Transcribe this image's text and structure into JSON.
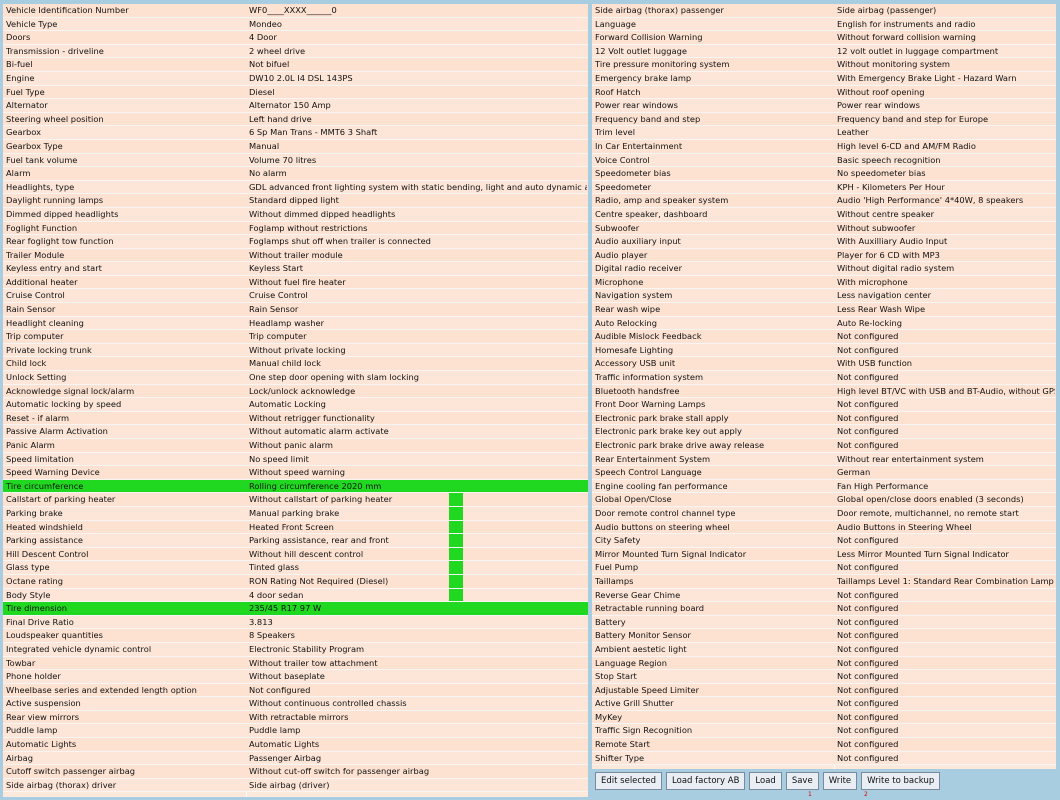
{
  "left_rows": [
    [
      "Vehicle Identification Number",
      "WF0____XXXX______0"
    ],
    [
      "Vehicle Type",
      "Mondeo"
    ],
    [
      "Doors",
      "4 Door"
    ],
    [
      "Transmission - driveline",
      "2 wheel drive"
    ],
    [
      "Bi-fuel",
      "Not bifuel"
    ],
    [
      "Engine",
      "DW10 2.0L I4 DSL 143PS"
    ],
    [
      "Fuel Type",
      "Diesel"
    ],
    [
      "Alternator",
      "Alternator 150 Amp"
    ],
    [
      "Steering wheel position",
      "Left hand drive"
    ],
    [
      "Gearbox",
      "6 Sp Man Trans - MMT6 3 Shaft"
    ],
    [
      "Gearbox Type",
      "Manual"
    ],
    [
      "Fuel tank volume",
      "Volume 70 litres"
    ],
    [
      "Alarm",
      "No alarm"
    ],
    [
      "Headlights, type",
      "GDL advanced front lighting system with static bending, light and auto dynamic adjust"
    ],
    [
      "Daylight running lamps",
      "Standard dipped light"
    ],
    [
      "Dimmed dipped headlights",
      "Without dimmed dipped headlights"
    ],
    [
      "Foglight Function",
      "Foglamp without restrictions"
    ],
    [
      "Rear foglight tow function",
      "Foglamps shut off when trailer is connected"
    ],
    [
      "Trailer Module",
      "Without trailer module"
    ],
    [
      "Keyless entry and start",
      "Keyless Start"
    ],
    [
      "Additional heater",
      "Without fuel fire heater"
    ],
    [
      "Cruise Control",
      "Cruise Control"
    ],
    [
      "Rain Sensor",
      "Rain Sensor"
    ],
    [
      "Headlight cleaning",
      "Headlamp washer"
    ],
    [
      "Trip computer",
      "Trip computer"
    ],
    [
      "Private locking trunk",
      "Without private locking"
    ],
    [
      "Child lock",
      "Manual child lock"
    ],
    [
      "Unlock Setting",
      "One step door opening with slam locking"
    ],
    [
      "Acknowledge signal lock/alarm",
      "Lock/unlock acknowledge"
    ],
    [
      "Automatic locking by speed",
      "Automatic Locking"
    ],
    [
      "Reset - if alarm",
      "Without retrigger functionality"
    ],
    [
      "Passive Alarm Activation",
      "Without automatic alarm activate"
    ],
    [
      "Panic Alarm",
      "Without panic alarm"
    ],
    [
      "Speed limitation",
      "No speed limit"
    ],
    [
      "Speed Warning Device",
      "Without speed warning"
    ],
    [
      "Tire circumference",
      "Rolling circumference 2020 mm"
    ],
    [
      "Callstart of parking heater",
      "Without callstart of parking heater"
    ],
    [
      "Parking brake",
      "Manual parking brake"
    ],
    [
      "Heated windshield",
      "Heated Front Screen"
    ],
    [
      "Parking assistance",
      "Parking assistance, rear and front"
    ],
    [
      "Hill Descent Control",
      "Without hill descent control"
    ],
    [
      "Glass type",
      "Tinted glass"
    ],
    [
      "Octane rating",
      "RON Rating Not Required (Diesel)"
    ],
    [
      "Body Style",
      "4 door sedan"
    ],
    [
      "Tire dimension",
      "235/45 R17 97 W"
    ],
    [
      "Final Drive Ratio",
      "3.813"
    ],
    [
      "Loudspeaker quantities",
      "8 Speakers"
    ],
    [
      "Integrated vehicle dynamic control",
      "Electronic Stability Program"
    ],
    [
      "Towbar",
      "Without trailer tow attachment"
    ],
    [
      "Phone holder",
      "Without baseplate"
    ],
    [
      "Wheelbase series and extended length option",
      "Not configured"
    ],
    [
      "Active suspension",
      "Without continuous controlled chassis"
    ],
    [
      "Rear view mirrors",
      "With retractable mirrors"
    ],
    [
      "Puddle lamp",
      "Puddle lamp"
    ],
    [
      "Automatic Lights",
      "Automatic Lights"
    ],
    [
      "Airbag",
      "Passenger Airbag"
    ],
    [
      "Cutoff switch passenger airbag",
      "Without cut-off switch for passenger airbag"
    ],
    [
      "Side airbag (thorax) driver",
      "Side airbag (driver)"
    ]
  ],
  "right_rows": [
    [
      "Side airbag (thorax) passenger",
      "Side airbag (passenger)"
    ],
    [
      "Language",
      "English for instruments and radio"
    ],
    [
      "Forward Collision Warning",
      "Without forward collision warning"
    ],
    [
      "12 Volt outlet luggage",
      "12 volt outlet in luggage compartment"
    ],
    [
      "Tire pressure monitoring system",
      "Without monitoring system"
    ],
    [
      "Emergency brake lamp",
      "With Emergency Brake Light - Hazard Warn"
    ],
    [
      "Roof Hatch",
      "Without roof opening"
    ],
    [
      "Power rear windows",
      "Power rear windows"
    ],
    [
      "Frequency band and step",
      "Frequency band and step for Europe"
    ],
    [
      "Trim level",
      "Leather"
    ],
    [
      "In Car Entertainment",
      "High level 6-CD and AM/FM Radio"
    ],
    [
      "Voice Control",
      "Basic speech recognition"
    ],
    [
      "Speedometer bias",
      "No speedometer bias"
    ],
    [
      "Speedometer",
      "KPH - Kilometers Per Hour"
    ],
    [
      "Radio, amp and speaker system",
      "Audio 'High Performance' 4*40W, 8 speakers"
    ],
    [
      "Centre speaker, dashboard",
      "Without centre speaker"
    ],
    [
      "Subwoofer",
      "Without subwoofer"
    ],
    [
      "Audio auxiliary input",
      "With Auxilliary Audio Input"
    ],
    [
      "Audio player",
      "Player for 6 CD with MP3"
    ],
    [
      "Digital radio receiver",
      "Without digital radio system"
    ],
    [
      "Microphone",
      "With microphone"
    ],
    [
      "Navigation system",
      "Less navigation center"
    ],
    [
      "Rear wash wipe",
      "Less Rear Wash Wipe"
    ],
    [
      "Auto Relocking",
      "Auto Re-locking"
    ],
    [
      "Audible Mislock Feedback",
      "Not configured"
    ],
    [
      "Homesafe Lighting",
      "Not configured"
    ],
    [
      "Accessory USB unit",
      "With USB function"
    ],
    [
      "Traffic information system",
      "Not configured"
    ],
    [
      "Bluetooth handsfree",
      "High level BT/VC with USB and BT-Audio, without GPS"
    ],
    [
      "Front Door Warning Lamps",
      "Not configured"
    ],
    [
      "Electronic park brake stall apply",
      "Not configured"
    ],
    [
      "Electronic park brake key out apply",
      "Not configured"
    ],
    [
      "Electronic park brake drive away release",
      "Not configured"
    ],
    [
      "Rear Entertainment System",
      "Without rear entertainment system"
    ],
    [
      "Speech Control Language",
      "German"
    ],
    [
      "Engine cooling fan performance",
      "Fan High Performance"
    ],
    [
      "Global Open/Close",
      "Global open/close doors enabled (3 seconds)"
    ],
    [
      "Door remote control channel type",
      "Door remote, multichannel, no remote start"
    ],
    [
      "Audio buttons on steering wheel",
      "Audio Buttons in Steering Wheel"
    ],
    [
      "City Safety",
      "Not configured"
    ],
    [
      "Mirror Mounted Turn Signal Indicator",
      "Less Mirror Mounted Turn Signal Indicator"
    ],
    [
      "Fuel Pump",
      "Not configured"
    ],
    [
      "Taillamps",
      "Taillamps Level 1: Standard Rear Combination Lamp"
    ],
    [
      "Reverse Gear Chime",
      "Not configured"
    ],
    [
      "Retractable running board",
      "Not configured"
    ],
    [
      "Battery",
      "Not configured"
    ],
    [
      "Battery Monitor Sensor",
      "Not configured"
    ],
    [
      "Ambient aestetic light",
      "Not configured"
    ],
    [
      "Language Region",
      "Not configured"
    ],
    [
      "Stop Start",
      "Not configured"
    ],
    [
      "Adjustable Speed Limiter",
      "Not configured"
    ],
    [
      "Active Grill Shutter",
      "Not configured"
    ],
    [
      "MyKey",
      "Not configured"
    ],
    [
      "Traffic Sign Recognition",
      "Not configured"
    ],
    [
      "Remote Start",
      "Not configured"
    ],
    [
      "Shifter Type",
      "Not configured"
    ]
  ],
  "highlight": {
    "full_rows": [
      35,
      44
    ],
    "side_rows_from": 36,
    "side_rows_to": 43,
    "color": "#21d821"
  },
  "toolbar": {
    "buttons": [
      "Edit selected",
      "Load factory AB",
      "Load",
      "Save",
      "Write",
      "Write to backup"
    ],
    "markers": [
      "1",
      "2"
    ]
  },
  "colors": {
    "background": "#a9cde0",
    "row": "#fde2d2",
    "highlight": "#21d821"
  }
}
